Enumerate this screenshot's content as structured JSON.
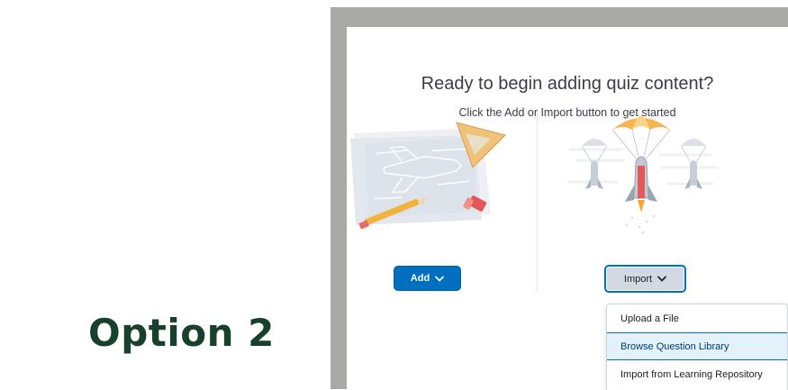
{
  "slide": {
    "option_label": "Option 2"
  },
  "quiz": {
    "heading": "Ready to begin adding quiz content?",
    "subheading": "Click the Add or Import button to get started",
    "add_button_label": "Add",
    "import_button_label": "Import",
    "import_menu": [
      {
        "label": "Upload a File",
        "selected": false
      },
      {
        "label": "Browse Question Library",
        "selected": true
      },
      {
        "label": "Import from Learning Repository",
        "selected": false
      }
    ],
    "illustrations": {
      "add": "rocket-blueprint-illustration",
      "import": "parachute-rocket-illustration"
    }
  },
  "colors": {
    "brand_green": "#17412c",
    "primary_blue": "#006fbf",
    "frame_gray": "#a9aaa5",
    "menu_highlight": "#e3f1fb"
  }
}
